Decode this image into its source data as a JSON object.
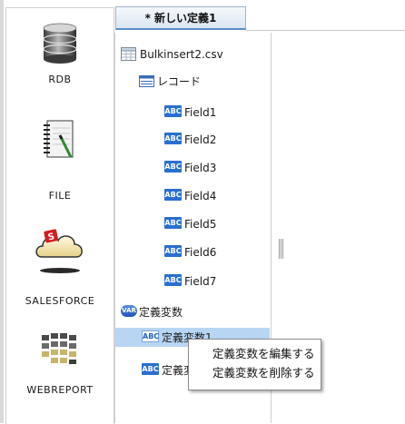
{
  "palette": {
    "items": [
      {
        "label": "RDB",
        "icon": "database-icon"
      },
      {
        "label": "FILE",
        "icon": "notepad-icon"
      },
      {
        "label": "SALESFORCE",
        "icon": "salesforce-cloud-icon"
      },
      {
        "label": "WEBREPORT",
        "icon": "webreport-grid-icon"
      }
    ]
  },
  "tab": {
    "label": "* 新しい定義1"
  },
  "tree": {
    "file": {
      "label": "Bulkinsert2.csv",
      "icon": "table-file-icon"
    },
    "record": {
      "label": "レコード",
      "icon": "record-icon"
    },
    "field_badge": "ABC",
    "fields": [
      {
        "label": "Field1"
      },
      {
        "label": "Field2"
      },
      {
        "label": "Field3"
      },
      {
        "label": "Field4"
      },
      {
        "label": "Field5"
      },
      {
        "label": "Field6"
      },
      {
        "label": "Field7"
      }
    ],
    "constants_group": {
      "label": "定義変数",
      "badge": "VAR"
    },
    "constants": [
      {
        "label": "定義変数1",
        "selected": true
      },
      {
        "label": "定義変数2",
        "selected": false
      }
    ]
  },
  "context_menu": {
    "items": [
      {
        "label": "定義変数を編集する"
      },
      {
        "label": "定義変数を削除する"
      }
    ]
  },
  "colors": {
    "selection": "#b8d6f3",
    "field_badge": "#2a6fd0",
    "tab_underline": "#5b8fc8"
  }
}
